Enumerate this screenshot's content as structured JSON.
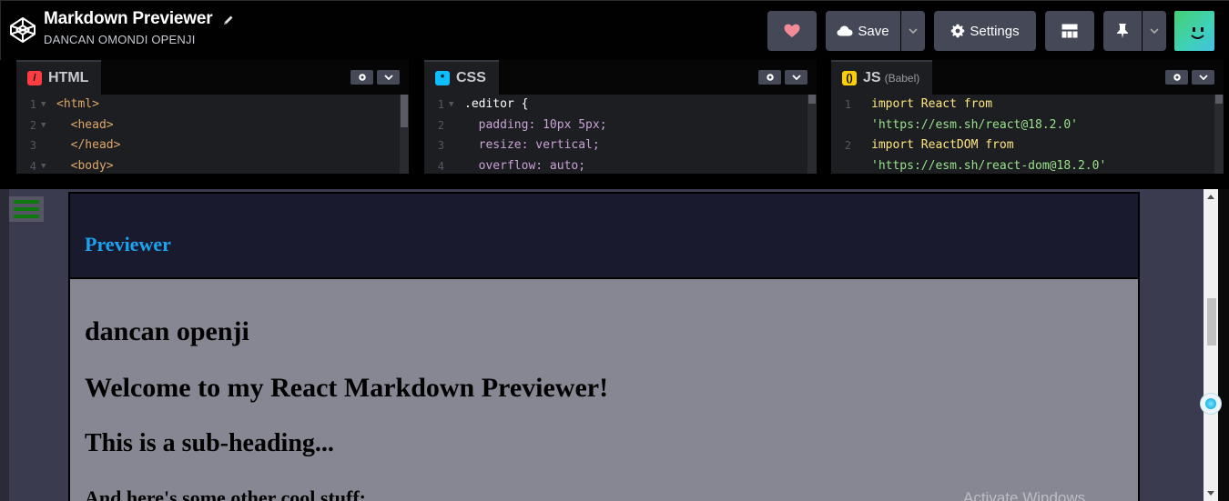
{
  "header": {
    "title": "Markdown Previewer",
    "author": "DANCAN OMONDI OPENJI",
    "save_label": "Save",
    "settings_label": "Settings"
  },
  "editors": {
    "html": {
      "name": "HTML",
      "lines": [
        {
          "n": "1",
          "text": "<html>"
        },
        {
          "n": "2",
          "text": "  <head>"
        },
        {
          "n": "3",
          "text": "  </head>"
        },
        {
          "n": "4",
          "text": "  <body>"
        }
      ]
    },
    "css": {
      "name": "CSS",
      "lines": [
        {
          "n": "1",
          "text": ".editor {"
        },
        {
          "n": "2",
          "text": "  padding: 10px 5px;"
        },
        {
          "n": "3",
          "text": "  resize: vertical;"
        },
        {
          "n": "4",
          "text": "  overflow: auto;"
        }
      ]
    },
    "js": {
      "name": "JS",
      "sub": "(Babel)",
      "lines": [
        {
          "n": "1",
          "text": "import React from"
        },
        {
          "n": "",
          "text": "'https://esm.sh/react@18.2.0'"
        },
        {
          "n": "2",
          "text": "import ReactDOM from"
        },
        {
          "n": "",
          "text": "'https://esm.sh/react-dom@18.2.0'"
        }
      ]
    }
  },
  "preview": {
    "toolbar_title": "Previewer",
    "h1": "dancan openji",
    "h2": "Welcome to my React Markdown Previewer!",
    "h3": "This is a sub-heading...",
    "h4": "And here's some other cool stuff:"
  },
  "watermark": "Activate Windows",
  "colors": {
    "accent_blue": "#1ba3ef",
    "html_icon": "#ff3c41",
    "css_icon": "#0ebeff",
    "js_icon": "#fcd000"
  }
}
